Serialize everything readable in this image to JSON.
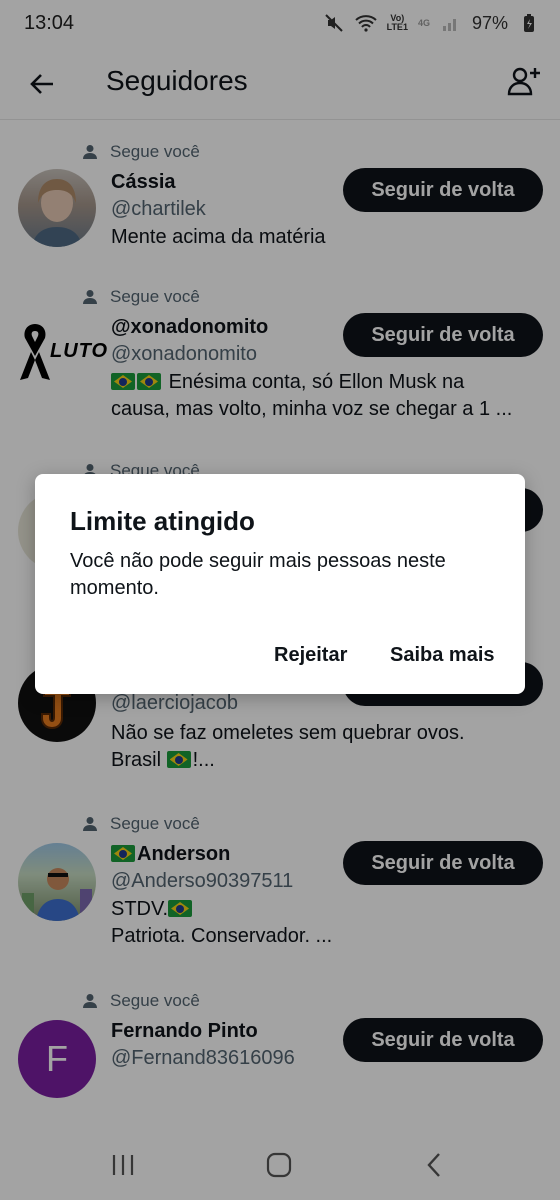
{
  "status_bar": {
    "time": "13:04",
    "volte_label": "Vo)\nLTE1",
    "network": "4G",
    "battery": "97%"
  },
  "header": {
    "title": "Seguidores",
    "icons": {
      "back": "arrow-left-icon",
      "add_user": "person-add-icon"
    }
  },
  "followers": [
    {
      "follows_you": "Segue você",
      "name": "Cássia",
      "handle": "@chartilek",
      "bio": "Mente acima da matéria",
      "button": "Seguir de volta",
      "avatar_color": "#9aa6b0"
    },
    {
      "follows_you": "Segue você",
      "name": "@xonadonomito",
      "handle": "@xonadonomito",
      "bio_line1": "Enésima conta, só Ellon Musk na",
      "bio_line2": "causa, mas  volto, minha voz se chegar a 1 ...",
      "button": "Seguir de volta",
      "avatar_text": "LUTO"
    },
    {
      "follows_you": "Segue você",
      "handle": "@laerciojacob",
      "bio_line1": "Não se faz omeletes sem quebrar ovos.",
      "bio_line2_prefix": "Brasil",
      "bio_line2_suffix": "!..."
    },
    {
      "follows_you": "Segue você",
      "name": "Anderson",
      "handle": "@Anderso90397511",
      "bio_line1": "STDV.",
      "bio_line2": "Patriota. Conservador. ...",
      "button": "Seguir de volta"
    },
    {
      "follows_you": "Segue você",
      "name": "Fernando Pinto",
      "handle": "@Fernand83616096",
      "button": "Seguir de volta",
      "avatar_letter": "F",
      "avatar_color": "#7b1fa2"
    }
  ],
  "dialog": {
    "title": "Limite atingido",
    "message": "Você não pode seguir mais pessoas neste momento.",
    "reject": "Rejeitar",
    "learn_more": "Saiba mais"
  },
  "colors": {
    "button_bg": "#0f1419",
    "secondary_text": "#536471",
    "scrim": "rgba(0,0,0,0.36)"
  }
}
